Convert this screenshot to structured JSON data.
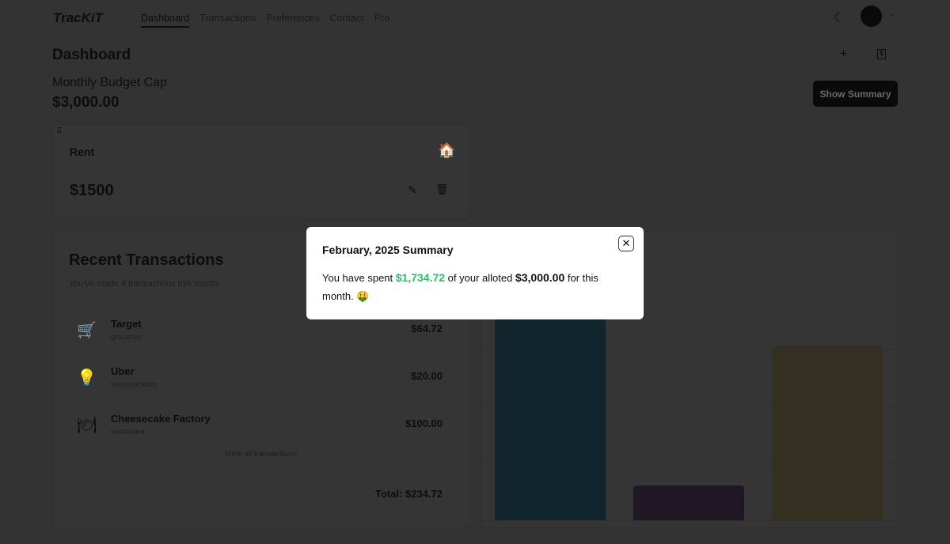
{
  "nav": {
    "logo": "TracKiT",
    "links": [
      "Dashboard",
      "Transactions",
      "Preferences",
      "Contact",
      "Pro"
    ],
    "active": "Dashboard"
  },
  "header": {
    "title": "Dashboard",
    "budget_label": "Monthly Budget Cap",
    "budget_value": "$3,000.00",
    "show_summary": "Show Summary"
  },
  "rent_card": {
    "title": "Rent",
    "amount": "$1500",
    "icon": "🏠"
  },
  "recent": {
    "title": "Recent Transactions",
    "subtitle": "You've made 4 transactions this month.",
    "items": [
      {
        "name": "Target",
        "category": "groceries",
        "amount": "$64.72",
        "icon": "🛒"
      },
      {
        "name": "Uber",
        "category": "transportation",
        "amount": "$20.00",
        "icon": "💡"
      },
      {
        "name": "Cheesecake Factory",
        "category": "restaurant",
        "amount": "$100.00",
        "icon": "🍽"
      }
    ],
    "view_all": "View all transactions",
    "total": "Total: $234.72"
  },
  "chart_data": {
    "type": "bar",
    "series": [
      {
        "values": [
          125,
          20,
          100
        ],
        "colors": [
          "#50b9dc",
          "#9b73b4",
          "#fff0aa"
        ]
      }
    ],
    "ylim": [
      0,
      150
    ],
    "grid": true
  },
  "modal": {
    "title": "February, 2025 Summary",
    "text1": "You have spent ",
    "spent": "$1,734.72",
    "text2": " of your alloted ",
    "allotted": "$3,000.00",
    "text3": " for this month. ",
    "emoji": "🤑"
  }
}
